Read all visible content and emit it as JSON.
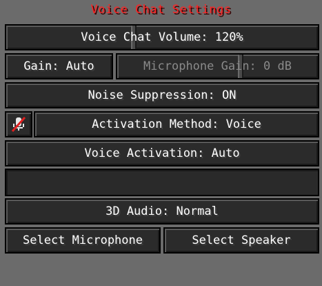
{
  "title": "Voice Chat Settings",
  "colors": {
    "title": "#ff2222",
    "background": "#6b6b6b",
    "button_bg": "#2b2b2b",
    "disabled_text": "#8a8a8a",
    "mic_slash": "#e02020"
  },
  "controls": {
    "voice_chat_volume": {
      "label": "Voice Chat Volume: 120%",
      "value_percent": 120
    },
    "gain": {
      "label": "Gain: Auto"
    },
    "microphone_gain": {
      "label": "Microphone Gain: 0 dB",
      "value_db": 0,
      "enabled": false
    },
    "noise_suppression": {
      "label": "Noise Suppression: ON"
    },
    "mic_toggle": {
      "icon": "microphone-muted-icon"
    },
    "activation_method": {
      "label": "Activation Method: Voice"
    },
    "voice_activation": {
      "label": "Voice Activation: Auto"
    },
    "audio_3d": {
      "label": "3D Audio: Normal"
    },
    "select_microphone": {
      "label": "Select Microphone"
    },
    "select_speaker": {
      "label": "Select Speaker"
    }
  }
}
